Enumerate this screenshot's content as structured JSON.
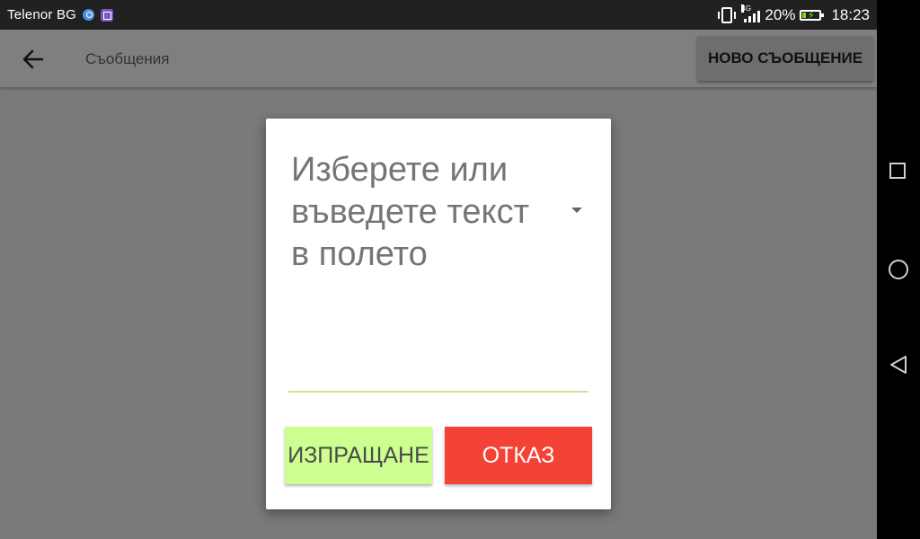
{
  "status_bar": {
    "carrier": "Telenor BG",
    "network": "4G",
    "battery_percent": "20%",
    "time": "18:23"
  },
  "toolbar": {
    "back_icon": "arrow-left-icon",
    "title": "Съобщения",
    "new_message_label": "НОВО СЪОБЩЕНИЕ"
  },
  "dialog": {
    "spinner_text": "Изберете или въведете текст в полето",
    "send_label": "ИЗПРАЩАНЕ",
    "cancel_label": "ОТКАЗ"
  },
  "nav_bar": {
    "recents_icon": "square-icon",
    "home_icon": "circle-icon",
    "back_icon": "triangle-back-icon"
  },
  "colors": {
    "send_button": "#ccff90",
    "cancel_button": "#f44336",
    "underline": "#c9e59a",
    "scrim": "#7a7a7a"
  }
}
